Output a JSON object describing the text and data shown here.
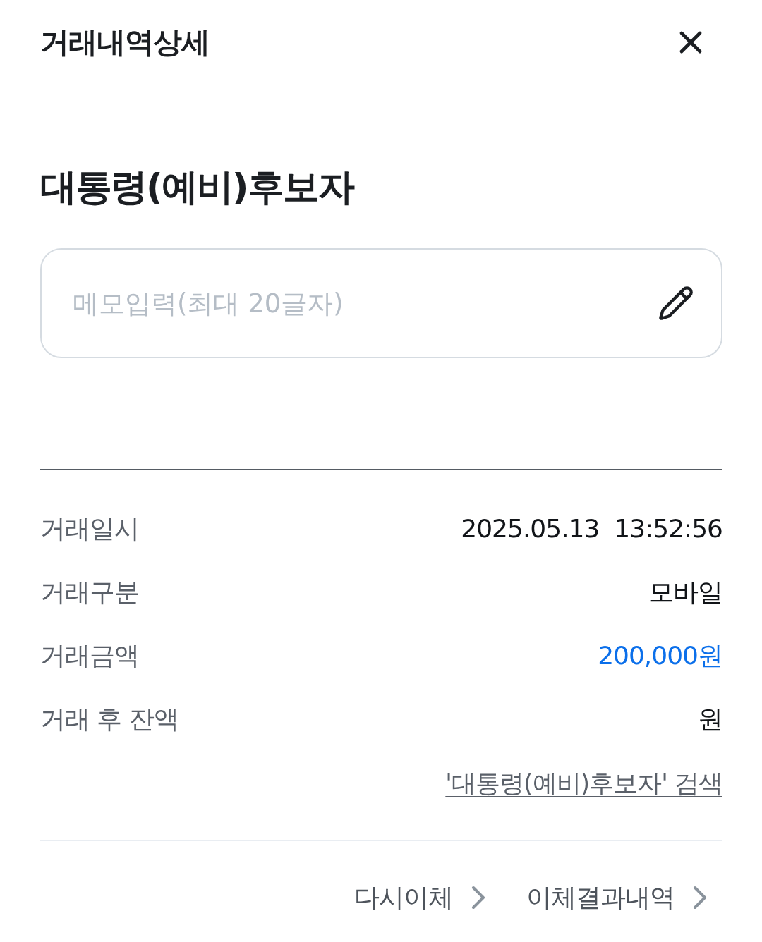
{
  "header": {
    "title": "거래내역상세"
  },
  "payee": {
    "name": "대통령(예비)후보자"
  },
  "memo": {
    "placeholder": "메모입력(최대 20글자)"
  },
  "details": [
    {
      "label": "거래일시",
      "value": "2025.05.13  13:52:56",
      "kind": "plain"
    },
    {
      "label": "거래구분",
      "value": "모바일",
      "kind": "plain"
    },
    {
      "label": "거래금액",
      "value": "200,000원",
      "kind": "amount"
    },
    {
      "label": "거래 후 잔액",
      "value": "원",
      "kind": "plain"
    }
  ],
  "search_link": {
    "label": "'대통령(예비)후보자' 검색"
  },
  "actions": [
    {
      "label": "다시이체"
    },
    {
      "label": "이체결과내역"
    }
  ]
}
